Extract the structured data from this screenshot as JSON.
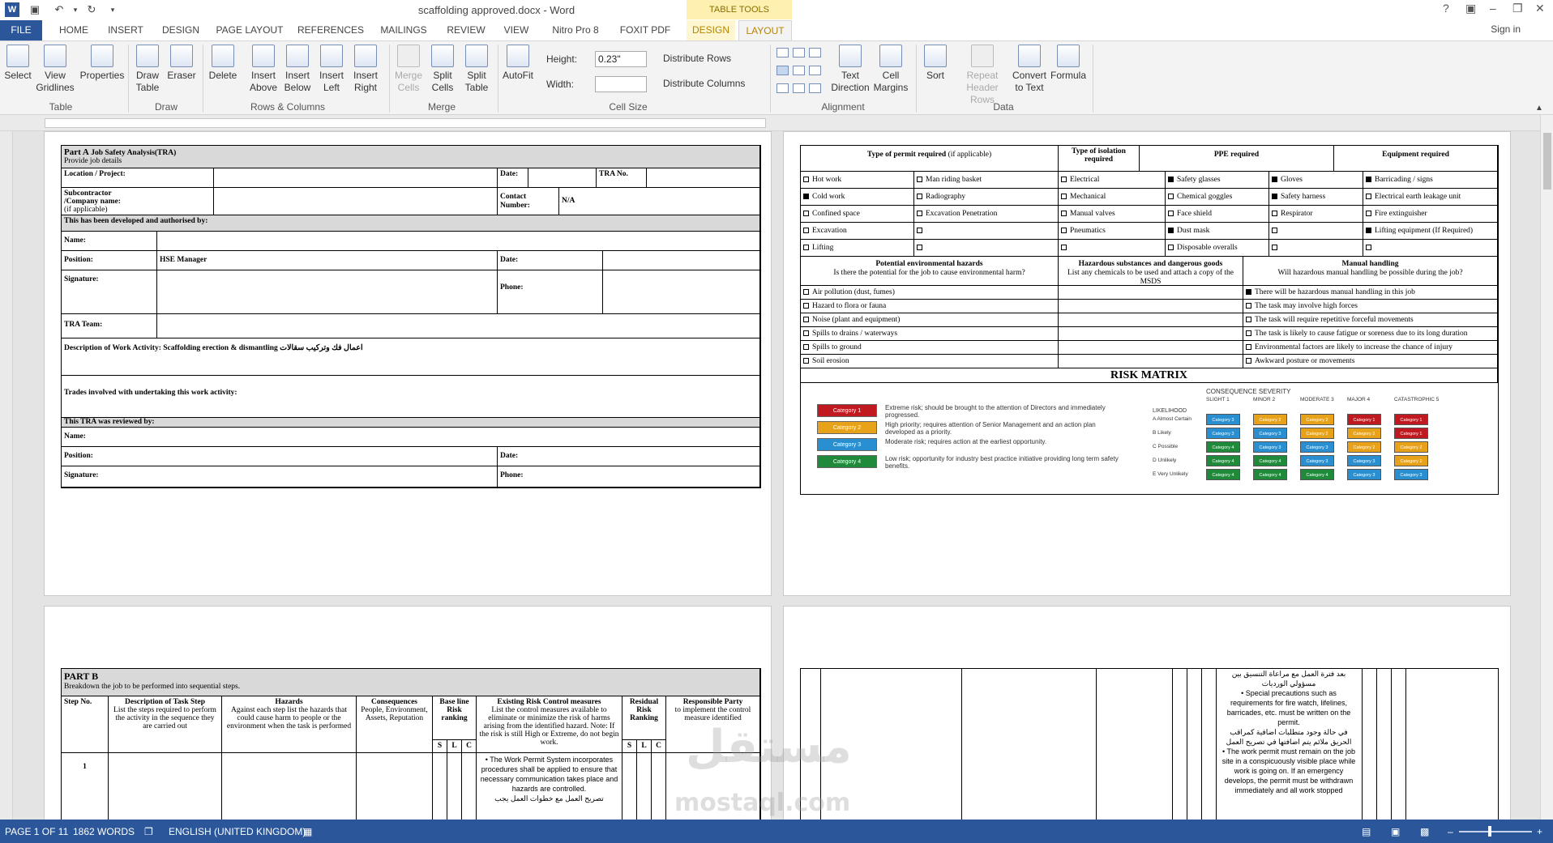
{
  "title_bar": {
    "document_title": "scaffolding approved.docx - Word",
    "contextual_header": "TABLE TOOLS"
  },
  "tabs": [
    {
      "label": "FILE"
    },
    {
      "label": "HOME"
    },
    {
      "label": "INSERT"
    },
    {
      "label": "DESIGN"
    },
    {
      "label": "PAGE LAYOUT"
    },
    {
      "label": "REFERENCES"
    },
    {
      "label": "MAILINGS"
    },
    {
      "label": "REVIEW"
    },
    {
      "label": "VIEW"
    },
    {
      "label": "Nitro Pro 8"
    },
    {
      "label": "FOXIT PDF"
    },
    {
      "label": "DESIGN"
    },
    {
      "label": "LAYOUT"
    }
  ],
  "sign_in": "Sign in",
  "ribbon": {
    "table": {
      "group": "Table",
      "select": "Select",
      "view_gridlines": [
        "View",
        "Gridlines"
      ],
      "properties": "Properties"
    },
    "draw": {
      "group": "Draw",
      "draw_table": [
        "Draw",
        "Table"
      ],
      "eraser": "Eraser"
    },
    "rows_columns": {
      "group": "Rows & Columns",
      "delete": "Delete",
      "insert_above": [
        "Insert",
        "Above"
      ],
      "insert_below": [
        "Insert",
        "Below"
      ],
      "insert_left": [
        "Insert",
        "Left"
      ],
      "insert_right": [
        "Insert",
        "Right"
      ]
    },
    "merge": {
      "group": "Merge",
      "merge_cells": [
        "Merge",
        "Cells"
      ],
      "split_cells": [
        "Split",
        "Cells"
      ],
      "split_table": [
        "Split",
        "Table"
      ]
    },
    "cell_size": {
      "group": "Cell Size",
      "autofit": "AutoFit",
      "height_label": "Height:",
      "height_value": "0.23\"",
      "width_label": "Width:",
      "width_value": "",
      "distribute_rows": "Distribute Rows",
      "distribute_columns": "Distribute Columns"
    },
    "alignment": {
      "group": "Alignment",
      "text_direction": [
        "Text",
        "Direction"
      ],
      "cell_margins": [
        "Cell",
        "Margins"
      ]
    },
    "data": {
      "group": "Data",
      "sort": "Sort",
      "repeat_header_rows": [
        "Repeat",
        "Header Rows"
      ],
      "convert_to_text": [
        "Convert",
        "to Text"
      ],
      "formula": "Formula"
    }
  },
  "page1": {
    "part_a": "Part A",
    "part_a_title": "Job Safety Analysis(TRA)",
    "provide": "Provide job details",
    "location": "Location / Project:",
    "date": "Date:",
    "tra_no": "TRA No.",
    "subcontractor": [
      "Subcontractor",
      "/Company name:",
      "(if applicable)"
    ],
    "contact": [
      "Contact",
      "Number:"
    ],
    "contact_value": "N/A",
    "developed": "This has been developed and authorised by:",
    "name": "Name:",
    "position": "Position:",
    "position_value": "HSE Manager",
    "signature": "Signature:",
    "phone": "Phone:",
    "tra_team": "TRA Team:",
    "description": "Description of Work Activity: Scaffolding erection & dismantling اعمال فك وتركيب سقالات",
    "trades": "Trades involved with undertaking this work activity:",
    "reviewed": "This TRA was reviewed by:"
  },
  "page2": {
    "hdr_permit": "Type of permit required",
    "hdr_permit_suffix": "(if applicable)",
    "hdr_isolation": "Type of isolation required",
    "hdr_ppe": "PPE required",
    "hdr_equipment": "Equipment required",
    "permits": [
      {
        "label": "Hot work",
        "checked": false
      },
      {
        "label": "Cold work",
        "checked": true
      },
      {
        "label": "Confined space",
        "checked": false
      },
      {
        "label": "Excavation",
        "checked": false
      },
      {
        "label": "Lifting",
        "checked": false
      }
    ],
    "permits2": [
      "Man riding basket",
      "Radiography",
      "Excavation Penetration",
      "",
      ""
    ],
    "isolation": [
      "Electrical",
      "Mechanical",
      "Manual valves",
      "Pneumatics",
      ""
    ],
    "ppe1": [
      {
        "label": "Safety glasses",
        "checked": true
      },
      {
        "label": "Chemical goggles",
        "checked": false
      },
      {
        "label": "Face shield",
        "checked": false
      },
      {
        "label": "Dust mask",
        "checked": true
      },
      {
        "label": "Disposable overalls",
        "checked": false
      }
    ],
    "ppe2": [
      {
        "label": "Gloves",
        "checked": true
      },
      {
        "label": "Safety harness",
        "checked": true
      },
      {
        "label": "Respirator",
        "checked": false
      },
      {
        "label": "",
        "checked": false
      },
      {
        "label": "",
        "checked": false
      }
    ],
    "equipment": [
      {
        "label": "Barricading / signs",
        "checked": true
      },
      {
        "label": "Electrical earth leakage unit",
        "checked": false
      },
      {
        "label": "Fire extinguisher",
        "checked": false
      },
      {
        "label": "Lifting equipment  (If Required)",
        "checked": true
      },
      {
        "label": "",
        "checked": false
      }
    ],
    "env_hdr": "Potential environmental hazards",
    "env_sub": "Is there the potential for the job to cause environmental harm?",
    "haz_hdr": "Hazardous substances and dangerous goods",
    "haz_sub": "List any chemicals to be used and attach a copy of the MSDS",
    "manual_hdr": "Manual handling",
    "manual_sub": "Will hazardous manual handling be possible during the job?",
    "env": [
      "Air pollution (dust, fumes)",
      "Hazard to flora or fauna",
      "Noise (plant and equipment)",
      "Spills to drains / waterways",
      "Spills to ground",
      "Soil erosion"
    ],
    "manual": [
      {
        "label": "There will be hazardous manual handling in this job",
        "checked": true
      },
      {
        "label": "The task may involve high forces",
        "checked": false
      },
      {
        "label": "The task will require repetitive forceful movements",
        "checked": false
      },
      {
        "label": "The task is likely to cause fatigue or soreness due to its long duration",
        "checked": false
      },
      {
        "label": "Environmental factors are likely to increase the chance of injury",
        "checked": false
      },
      {
        "label": "Awkward posture or movements",
        "checked": false
      }
    ],
    "risk_matrix": "RISK MATRIX",
    "categories": [
      {
        "label": "Category 1",
        "color": "#c0191f",
        "desc": "Extreme risk; should be brought to the attention of Directors and immediately progressed."
      },
      {
        "label": "Category 2",
        "color": "#e8a21a",
        "desc": "High priority; requires attention of Senior Management and an action plan developed as a priority."
      },
      {
        "label": "Category 3",
        "color": "#2a8fd0",
        "desc": "Moderate risk; requires action at the earliest opportunity."
      },
      {
        "label": "Category 4",
        "color": "#1e8a3a",
        "desc": "Low risk; opportunity for industry best practice initiative providing long term safety benefits."
      }
    ],
    "consequence_title": "CONSEQUENCE SEVERITY",
    "consequences": [
      "SLIGHT 1",
      "MINOR 2",
      "MODERATE 3",
      "MAJOR 4",
      "CATASTROPHIC 5"
    ],
    "likelihood_title": "LIKELIHOOD",
    "likelihoods": [
      "A  Almost Certain",
      "B  Likely",
      "C  Possible",
      "D  Unlikely",
      "E  Very Unlikely"
    ],
    "matrix": [
      [
        3,
        2,
        2,
        1,
        1
      ],
      [
        3,
        3,
        2,
        2,
        1
      ],
      [
        4,
        3,
        3,
        2,
        2
      ],
      [
        4,
        4,
        3,
        3,
        2
      ],
      [
        4,
        4,
        4,
        3,
        3
      ]
    ]
  },
  "page3": {
    "part_b": "PART B",
    "breakdown": "Breakdown the job to be performed into sequential steps.",
    "step_no": "Step No.",
    "desc_hdr": "Description of Task Step",
    "desc_sub": "List the steps required to perform the activity in the sequence they are carried out",
    "haz_hdr": "Hazards",
    "haz_sub": "Against each step list the hazards that could cause harm to people or the environment when the task is performed",
    "cons_hdr": "Consequences",
    "cons_sub": "People, Environment, Assets, Reputation",
    "base_hdr": "Base line Risk ranking",
    "existing_hdr": "Existing Risk Control measures",
    "existing_sub": "List the control measures available to eliminate or minimize the risk of harms arising from the identified hazard. Note: If the risk is still High or Extreme, do not begin work.",
    "resid_hdr": "Residual Risk Ranking",
    "resp_hdr": "Responsible Party",
    "resp_sub": "to implement the control measure identified",
    "slc": [
      "S",
      "L",
      "C"
    ],
    "row1_no": "1",
    "row1_text": "The Work Permit System incorporates procedures shall be applied to ensure that necessary communication takes place and hazards are controlled.",
    "row1_arabic": "تصريح العمل مع خطوات العمل يجب"
  },
  "page4": {
    "arabic1": "بعد فترة العمل مع مراعاة التنسيق بين مسؤولي الورديات",
    "bullet1": "Special precautions such as requirements for fire watch, lifelines, barricades, etc. must be written on the permit.",
    "arabic2": "في حالة وجود متطلبات اضافية كمراقب الحريق ملائم يتم اضافتها في تصريح العمل",
    "bullet2": "The work permit must remain on the job site in a conspicuously visible place while work is going on. If an emergency develops, the permit must be withdrawn immediately and all work stopped"
  },
  "status_bar": {
    "page": "PAGE 1 OF 11",
    "words": "1862 WORDS",
    "language": "ENGLISH (UNITED KINGDOM)"
  },
  "watermark": {
    "arabic": "مستقل",
    "latin": "mostaql.com"
  }
}
